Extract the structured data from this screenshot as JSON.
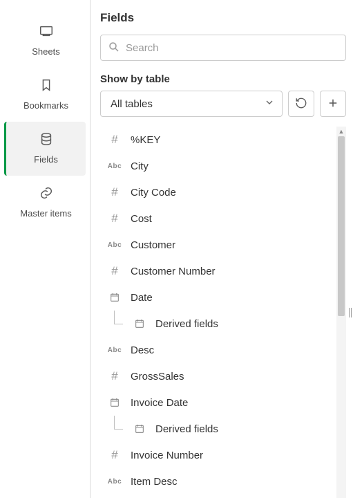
{
  "sidebar": {
    "items": [
      {
        "label": "Sheets"
      },
      {
        "label": "Bookmarks"
      },
      {
        "label": "Fields"
      },
      {
        "label": "Master items"
      }
    ]
  },
  "panel": {
    "title": "Fields",
    "search_placeholder": "Search",
    "showby_label": "Show by table",
    "dropdown_value": "All tables"
  },
  "fields": [
    {
      "type": "hash",
      "label": "%KEY"
    },
    {
      "type": "abc",
      "label": "City"
    },
    {
      "type": "hash",
      "label": "City Code"
    },
    {
      "type": "hash",
      "label": "Cost"
    },
    {
      "type": "abc",
      "label": "Customer"
    },
    {
      "type": "hash",
      "label": "Customer Number"
    },
    {
      "type": "date",
      "label": "Date"
    },
    {
      "type": "derived",
      "label": "Derived fields",
      "nested": true
    },
    {
      "type": "abc",
      "label": "Desc"
    },
    {
      "type": "hash",
      "label": "GrossSales"
    },
    {
      "type": "date",
      "label": "Invoice Date"
    },
    {
      "type": "derived",
      "label": "Derived fields",
      "nested": true
    },
    {
      "type": "hash",
      "label": "Invoice Number"
    },
    {
      "type": "abc",
      "label": "Item Desc"
    }
  ]
}
